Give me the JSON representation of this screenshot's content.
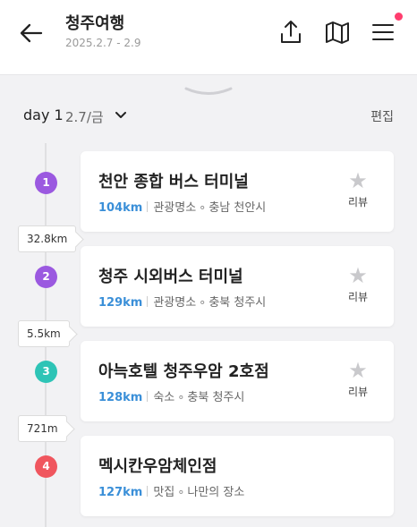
{
  "header": {
    "title": "청주여행",
    "dates": "2025.2.7 - 2.9",
    "icons": {
      "back": "arrow-left-icon",
      "share": "share-upload-icon",
      "map": "map-icon",
      "menu": "hamburger-menu-icon"
    },
    "notification_color": "#ff3d6e"
  },
  "day": {
    "label": "day 1",
    "date": "2.7/금",
    "edit_label": "편집"
  },
  "places": [
    {
      "number": "1",
      "color": "#9b59e0",
      "name": "천안 종합 버스 터미널",
      "distance": "104km",
      "category": "관광명소",
      "region": "충남 천안시",
      "review_label": "리뷰"
    },
    {
      "number": "2",
      "color": "#9b59e0",
      "name": "청주 시외버스 터미널",
      "distance": "129km",
      "category": "관광명소",
      "region": "충북 청주시",
      "review_label": "리뷰"
    },
    {
      "number": "3",
      "color": "#2ec4b6",
      "name": "아늑호텔 청주우암 2호점",
      "distance": "128km",
      "category": "숙소",
      "region": "충북 청주시",
      "review_label": "리뷰"
    },
    {
      "number": "4",
      "color": "#f0565e",
      "name": "멕시칸우암체인점",
      "distance": "127km",
      "category": "맛집",
      "region": "나만의 장소"
    }
  ],
  "legs": [
    "32.8km",
    "5.5km",
    "721m"
  ],
  "colors": {
    "distance_text": "#3a8fd8",
    "star": "#c9c9cc"
  }
}
